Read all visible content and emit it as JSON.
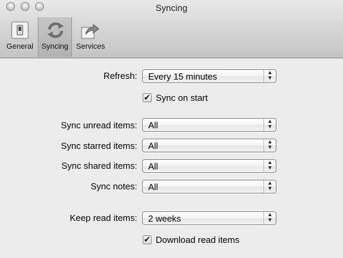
{
  "window": {
    "title": "Syncing"
  },
  "toolbar": {
    "tabs": [
      {
        "label": "General"
      },
      {
        "label": "Syncing"
      },
      {
        "label": "Services"
      }
    ]
  },
  "settings": {
    "refresh": {
      "label": "Refresh:",
      "value": "Every 15 minutes"
    },
    "sync_on_start": {
      "label": "Sync on start",
      "checked": true
    },
    "sync_unread": {
      "label": "Sync unread items:",
      "value": "All"
    },
    "sync_starred": {
      "label": "Sync starred items:",
      "value": "All"
    },
    "sync_shared": {
      "label": "Sync shared items:",
      "value": "All"
    },
    "sync_notes": {
      "label": "Sync notes:",
      "value": "All"
    },
    "keep_read": {
      "label": "Keep read items:",
      "value": "2 weeks"
    },
    "download_read": {
      "label": "Download read items",
      "checked": true
    }
  },
  "icons": {
    "general": "switch-icon",
    "syncing": "sync-arrows-icon",
    "services": "share-arrow-icon",
    "checkmark": "✔"
  }
}
